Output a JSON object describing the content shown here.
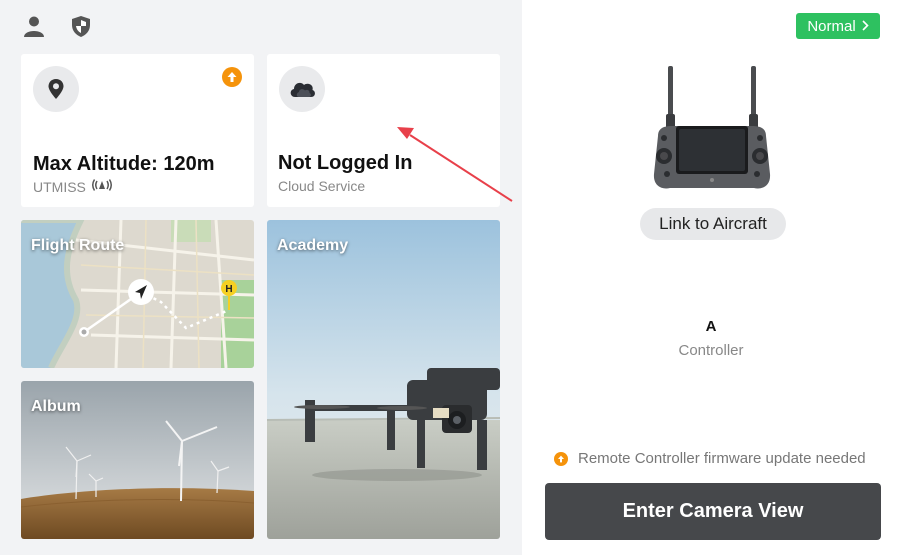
{
  "header": {
    "icons": [
      "user-icon",
      "shield-icon"
    ]
  },
  "cards": {
    "altitude": {
      "title": "Max Altitude: 120m",
      "subtitle": "UTMISS",
      "icon": "location-pin-icon",
      "badge_icon": "upload-arrow-icon",
      "badge_color": "#f5930b"
    },
    "cloud": {
      "title": "Not Logged In",
      "subtitle": "Cloud Service",
      "icon": "cloud-icon"
    }
  },
  "tiles": {
    "flight_route": "Flight Route",
    "academy": "Academy",
    "album": "Album"
  },
  "right_panel": {
    "status_label": "Normal",
    "status_color": "#2ec160",
    "link_button": "Link to Aircraft",
    "controller_name": "A",
    "controller_type": "Controller",
    "warning_text": "Remote Controller firmware update needed",
    "warning_color": "#f5930b",
    "enter_button": "Enter Camera View"
  }
}
